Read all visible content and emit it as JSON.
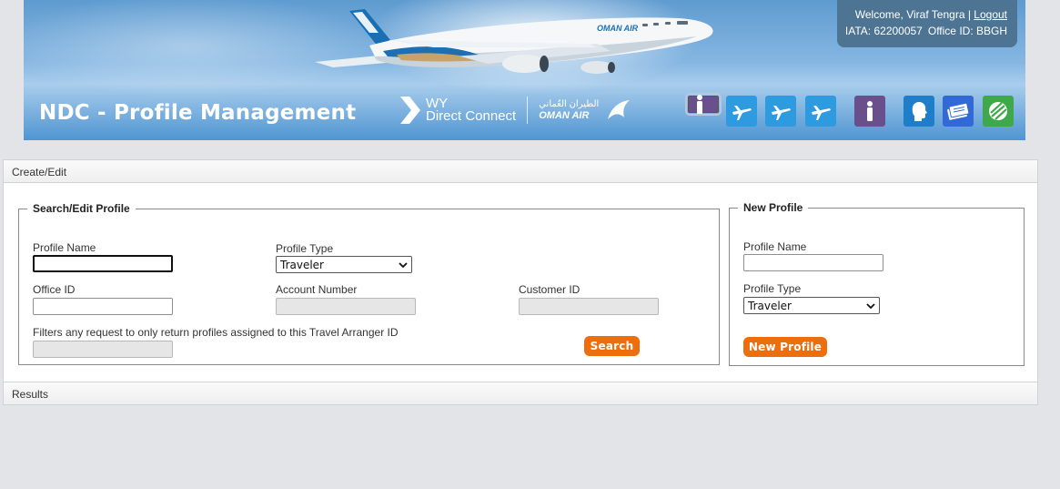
{
  "header": {
    "title": "NDC - Profile Management",
    "logo_wy_line1": "WY",
    "logo_wy_line2": "Direct Connect",
    "logo_oman_arabic": "الطيران العُماني",
    "logo_oman_english": "OMAN AIR",
    "plane_livery_text": "OMAN AIR"
  },
  "user": {
    "welcome": "Welcome, Viraf Tengra |",
    "logout": "Logout",
    "iata": "IATA: 62200057",
    "office": "Office ID: BBGH"
  },
  "nav_icons": [
    {
      "name": "person-icon",
      "color": "#6a4f8d"
    },
    {
      "name": "plane-icon",
      "color": "#2e9be0"
    },
    {
      "name": "plane-icon",
      "color": "#2e9be0"
    },
    {
      "name": "plane-icon",
      "color": "#2e9be0"
    },
    {
      "name": "person-icon",
      "color": "#6a4f8d"
    },
    {
      "name": "head-icon",
      "color": "#1f7ec9"
    },
    {
      "name": "tickets-icon",
      "color": "#3169d6"
    },
    {
      "name": "globe-icon",
      "color": "#3ea84a"
    }
  ],
  "sections": {
    "create_edit": "Create/Edit",
    "results": "Results"
  },
  "search_edit": {
    "legend": "Search/Edit Profile",
    "profile_name_label": "Profile Name",
    "profile_name_value": "",
    "profile_type_label": "Profile Type",
    "profile_type_value": "Traveler",
    "office_id_label": "Office ID",
    "office_id_value": "",
    "account_number_label": "Account Number",
    "customer_id_label": "Customer ID",
    "arranger_label": "Filters any request to only return profiles assigned to this Travel Arranger ID",
    "search_button": "Search"
  },
  "new_profile": {
    "legend": "New Profile",
    "profile_name_label": "Profile Name",
    "profile_name_value": "",
    "profile_type_label": "Profile Type",
    "profile_type_value": "Traveler",
    "new_profile_button": "New Profile"
  },
  "colors": {
    "accent_orange": "#ec6e0c",
    "welcome_box": "#4d7593",
    "page_bg": "#e3e4e8"
  }
}
